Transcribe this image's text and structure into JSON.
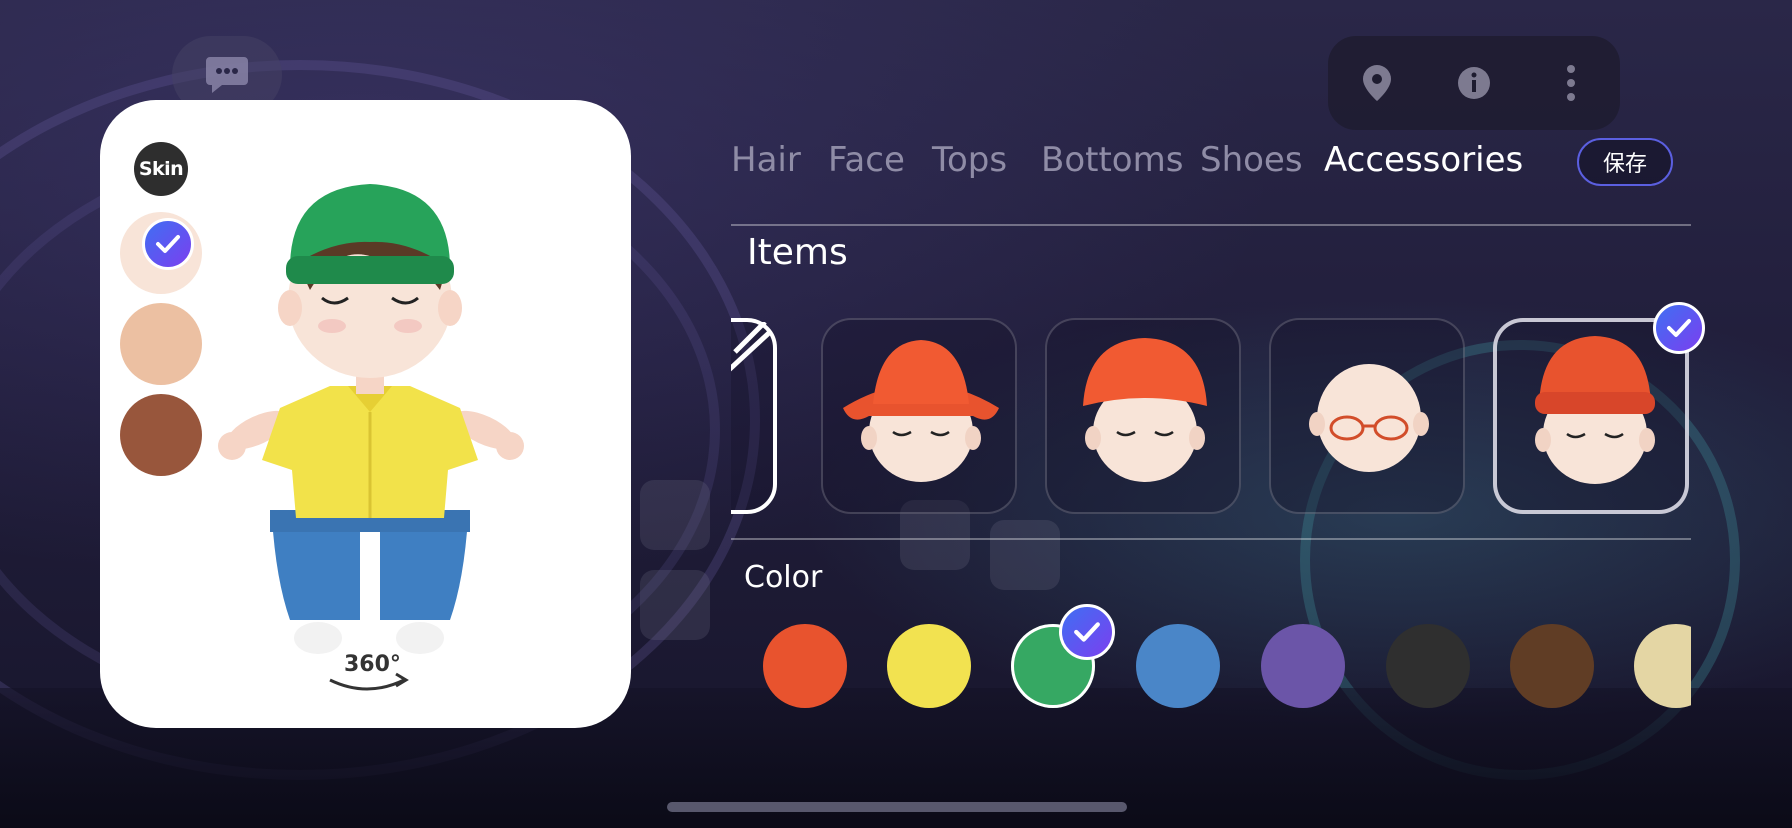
{
  "tabs": [
    {
      "label": "Hair",
      "active": false
    },
    {
      "label": "Face",
      "active": false
    },
    {
      "label": "Tops",
      "active": false
    },
    {
      "label": "Bottoms",
      "active": false
    },
    {
      "label": "Shoes",
      "active": false
    },
    {
      "label": "Accessories",
      "active": true
    }
  ],
  "save_label": "保存",
  "preview": {
    "skin_label": "Skin",
    "skin_tones": [
      {
        "color": "#f8e4d8",
        "selected": true
      },
      {
        "color": "#ecc0a2",
        "selected": false
      },
      {
        "color": "#98563c",
        "selected": false
      }
    ],
    "rotate_label": "360°"
  },
  "items_section": {
    "title": "Items",
    "items": [
      {
        "icon": "none-slash-icon",
        "selected": false
      },
      {
        "icon": "bucket-hat-orange-icon",
        "selected": false
      },
      {
        "icon": "cap-orange-icon",
        "selected": false
      },
      {
        "icon": "glasses-icon",
        "selected": false
      },
      {
        "icon": "beanie-orange-icon",
        "selected": true
      }
    ]
  },
  "color_section": {
    "title": "Color",
    "colors": [
      {
        "hex": "#e8532e",
        "selected": false
      },
      {
        "hex": "#f2e250",
        "selected": false
      },
      {
        "hex": "#36a863",
        "selected": true
      },
      {
        "hex": "#4a86c8",
        "selected": false
      },
      {
        "hex": "#6b55a8",
        "selected": false
      },
      {
        "hex": "#2f2f2f",
        "selected": false
      },
      {
        "hex": "#603d25",
        "selected": false
      },
      {
        "hex": "#e4d6a4",
        "selected": false
      }
    ]
  },
  "accent": "#5b5fe0"
}
